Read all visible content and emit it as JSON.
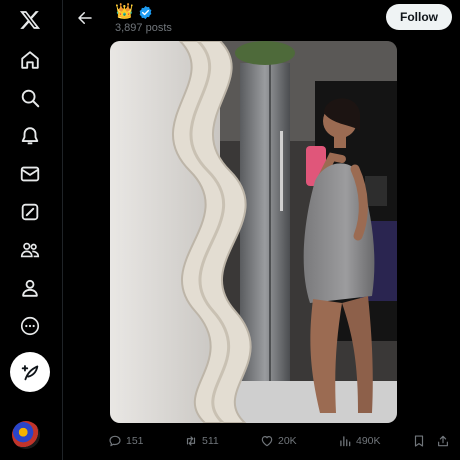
{
  "header": {
    "display_name": "👑",
    "post_count": "3,897 posts",
    "follow_label": "Follow"
  },
  "sidebar": {
    "items": [
      {
        "icon": "home-icon"
      },
      {
        "icon": "search-icon"
      },
      {
        "icon": "bell-icon"
      },
      {
        "icon": "mail-icon"
      },
      {
        "icon": "grok-icon"
      },
      {
        "icon": "communities-icon"
      },
      {
        "icon": "profile-icon"
      },
      {
        "icon": "more-icon"
      }
    ]
  },
  "post": {
    "media_description": "Mirror selfie photo",
    "stats": {
      "replies": "151",
      "reposts": "511",
      "likes": "20K",
      "views": "490K"
    }
  },
  "colors": {
    "background": "#000000",
    "muted_text": "#71767b",
    "verified": "#1d9bf0",
    "follow_bg": "#eff3f4"
  }
}
